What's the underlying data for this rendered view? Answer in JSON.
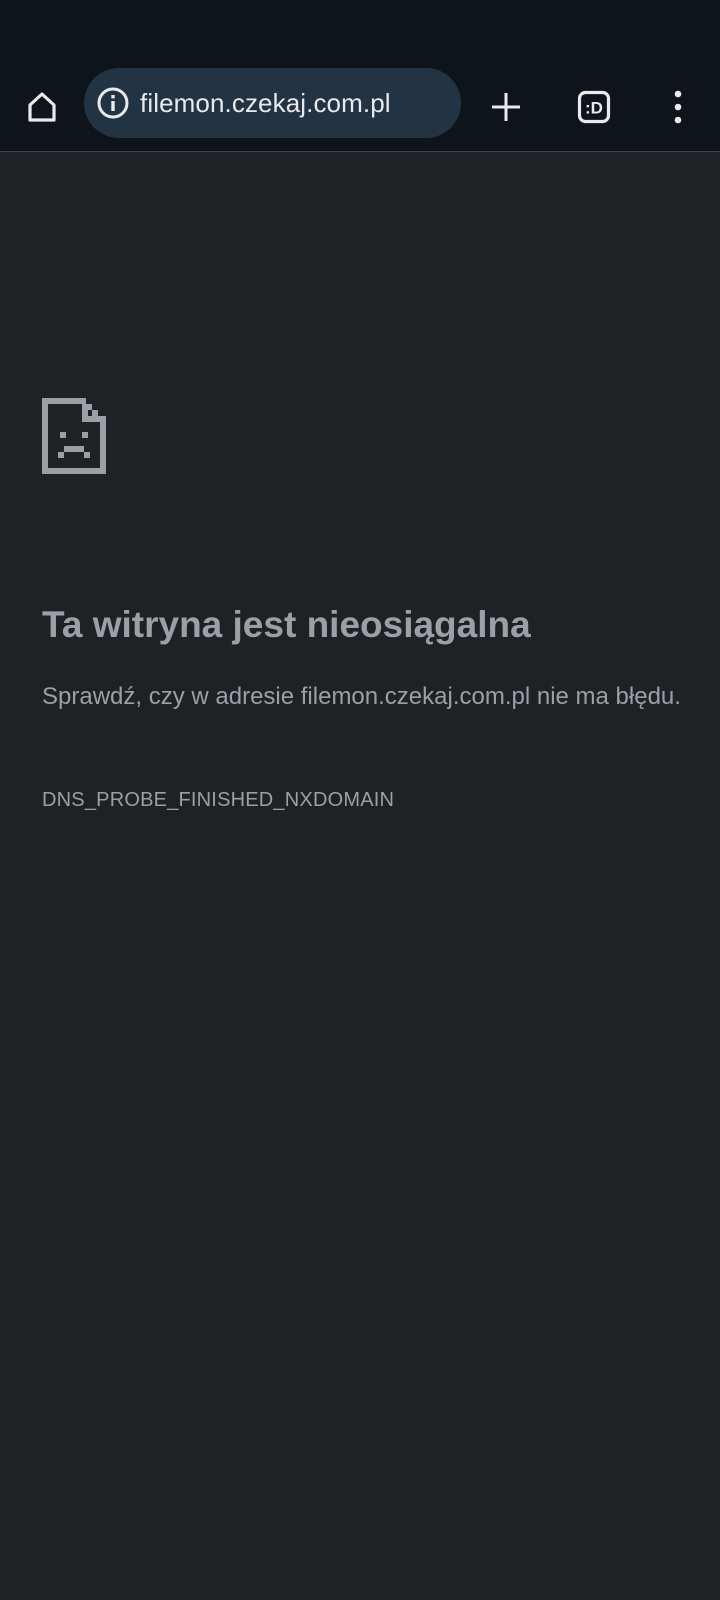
{
  "toolbar": {
    "home_icon": "home-icon",
    "info_icon": "info-icon",
    "url": "filemon.czekaj.com.pl",
    "new_tab_icon": "plus-icon",
    "tab_switcher_label": ":D",
    "menu_icon": "more-vertical-icon"
  },
  "error_page": {
    "icon": "sad-document-icon",
    "title": "Ta witryna jest nieosiągalna",
    "description": "Sprawdź, czy w adresie filemon.czekaj.com.pl nie ma błędu.",
    "error_code": "DNS_PROBE_FINISHED_NXDOMAIN"
  },
  "colors": {
    "toolbar_bg": "#0f141b",
    "omnibox_bg": "#223444",
    "page_bg": "#202124",
    "text_muted": "#9aa0a6",
    "icon_light": "#e8eaed"
  }
}
